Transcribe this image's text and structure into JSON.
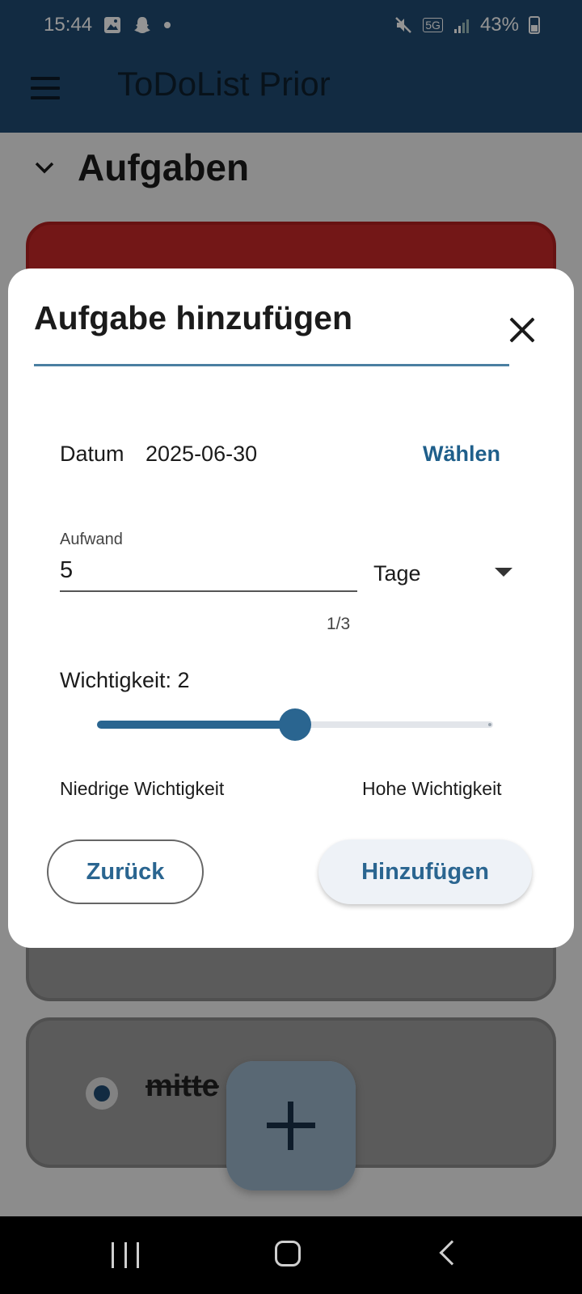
{
  "status_bar": {
    "time": "15:44",
    "network": "5G",
    "battery": "43%"
  },
  "app_bar": {
    "title": "ToDoList Prior",
    "menu_icon": "hamburger-menu-icon"
  },
  "section": {
    "title": "Aufgaben",
    "icon": "chevron-down-icon"
  },
  "background_tasks": [
    {
      "text": "mitte",
      "state": "completed"
    }
  ],
  "dialog": {
    "title": "Aufgabe hinzufügen",
    "close_icon": "close-icon",
    "date_label": "Datum",
    "date_value": "2025-06-30",
    "choose_label": "Wählen",
    "effort_label": "Aufwand",
    "effort_value": "5",
    "effort_counter": "1/3",
    "unit_value": "Tage",
    "importance_label": "Wichtigkeit: 2",
    "importance_slider": {
      "value": 2,
      "min": 0,
      "max": 4,
      "fraction": 0.5
    },
    "low_label": "Niedrige Wichtigkeit",
    "high_label": "Hohe Wichtigkeit",
    "back_label": "Zurück",
    "add_label": "Hinzufügen"
  },
  "fab": {
    "icon": "plus-icon"
  },
  "colors": {
    "primary": "#1f4b73",
    "accent": "#2a6590",
    "urgent_card": "#c62828"
  }
}
